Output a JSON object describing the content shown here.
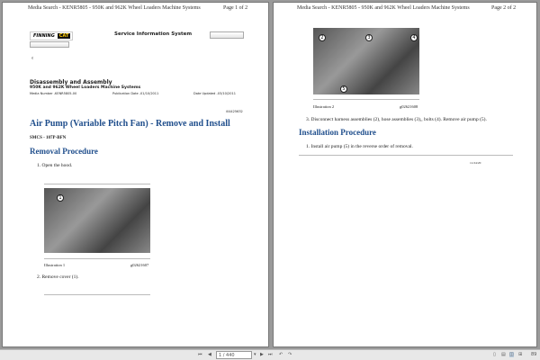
{
  "page1": {
    "header": "Media Search - KENR5805 - 950K and 962K Wheel Loaders Machine Systems",
    "page_num": "Page 1 of 2",
    "logo_text": "FINNING",
    "logo_cat": "CAT",
    "sis": "Service Information System",
    "mark": "¢",
    "section": "Disassembly and Assembly",
    "subsection": "950K and 962K Wheel Loaders Machine Systems",
    "media": "Media Number -KENR5805-00",
    "pub": "Publication Date -01/10/2011",
    "updated": "Date Updated -03/10/2011",
    "docid": "i04425632",
    "title": "Air Pump (Variable Pitch Fan) - Remove and Install",
    "smcs": "SMCS - 107P-BFN",
    "removal": "Removal Procedure",
    "step1": "1.  Open the hood.",
    "ill_label": "Illustration 1",
    "ill_id": "g02621607",
    "callout": "1",
    "step2": "2.  Remove cover (1)."
  },
  "page2": {
    "header": "Media Search - KENR5805 - 950K and 962K Wheel Loaders Machine Systems",
    "page_num": "Page 2 of 2",
    "callouts": [
      "2",
      "3",
      "4",
      "5"
    ],
    "ill_label": "Illustration 2",
    "ill_id": "g02621608",
    "step3": "3.  Disconnect harness assemblies (2), hose assemblies (3),, bolts (4). Remove air pump (5).",
    "install": "Installation Procedure",
    "istep1": "1.  Install air pump (5) in the reverse order of removal.",
    "footer": "11/24/20"
  },
  "toolbar": {
    "page_value": "1 / 440",
    "zoom": "89"
  }
}
